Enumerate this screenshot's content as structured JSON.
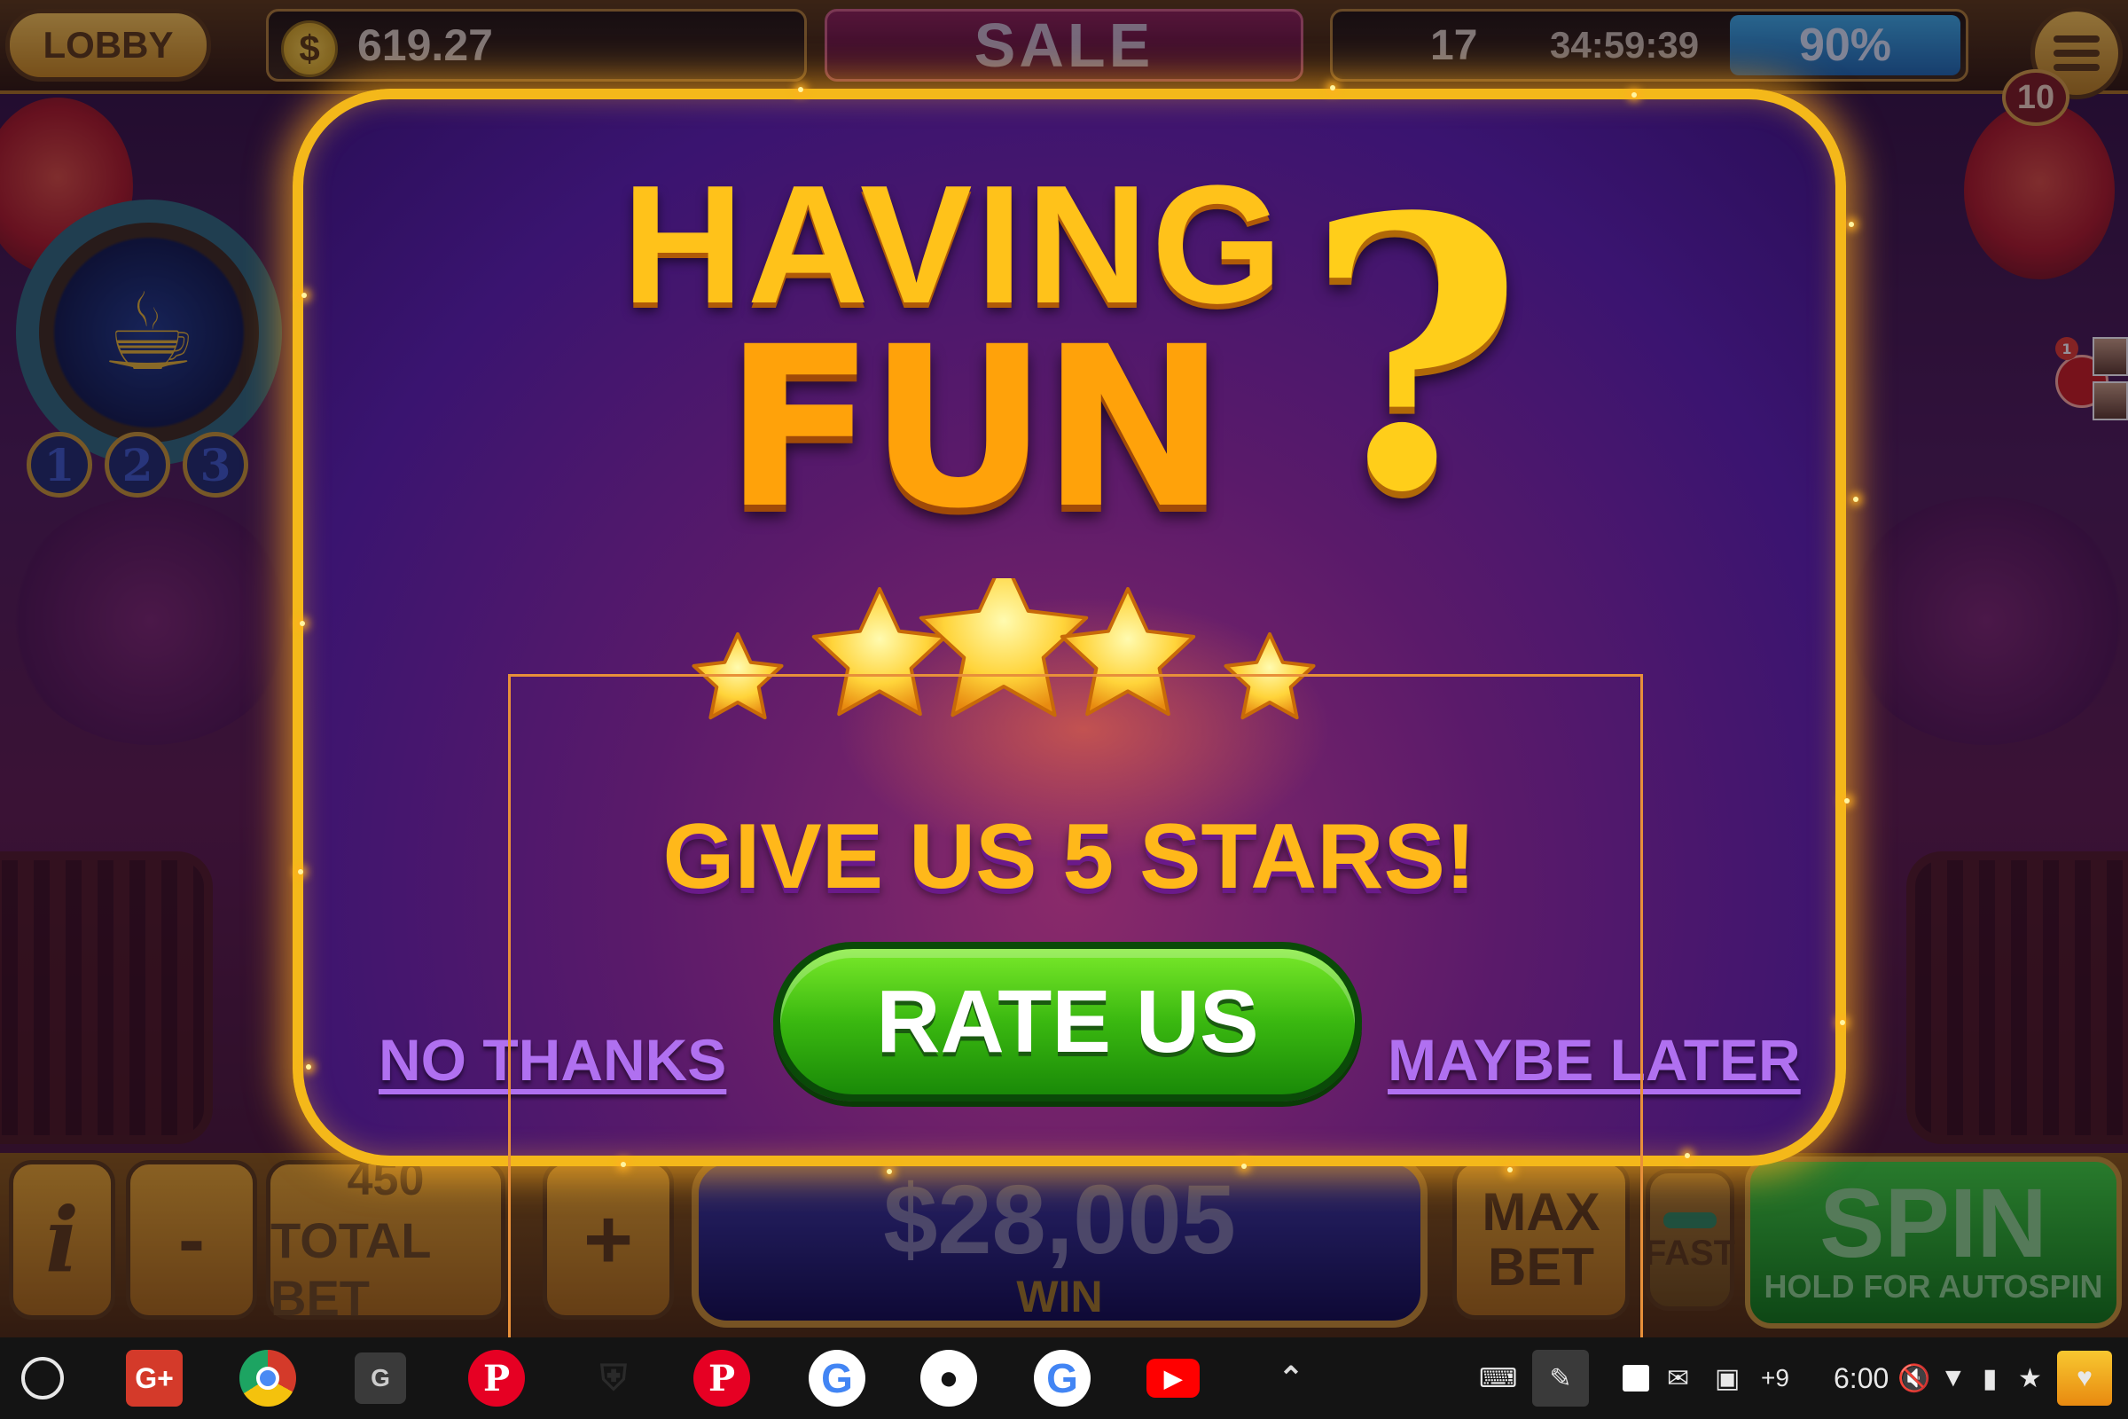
{
  "hud": {
    "lobby_label": "LOBBY",
    "coin_symbol": "$",
    "balance": "619.27",
    "sale_label": "SALE",
    "level": "17",
    "timer": "34:59:39",
    "xp_percent": "90%",
    "notification_count": "10"
  },
  "lamp": {
    "icon": "genie-lamp-icon",
    "levels": [
      "1",
      "2",
      "3"
    ]
  },
  "friends": {
    "badge_count": "1"
  },
  "popup": {
    "title_line1": "HAVING",
    "title_line2": "FUN",
    "title_mark": "?",
    "stars_shown": 5,
    "cta_text": "GIVE US 5 STARS!",
    "rate_button": "RATE US",
    "no_thanks": "NO THANKS",
    "maybe_later": "MAYBE LATER",
    "border_color": "#f4b81a",
    "button_color": "#3ab810"
  },
  "bottom_bar": {
    "info_label": "i",
    "minus_label": "-",
    "total_bet_value": "450",
    "total_bet_label": "TOTAL BET",
    "plus_label": "+",
    "win_value": "$28,005",
    "win_label": "WIN",
    "max_bet_line1": "MAX",
    "max_bet_line2": "BET",
    "fast_label": "FAST",
    "spin_label": "SPIN",
    "spin_sub": "HOLD FOR AUTOSPIN"
  },
  "taskbar": {
    "apps": [
      "launcher-icon",
      "google-plus-icon",
      "chrome-icon",
      "g-app-icon",
      "pinterest-icon",
      "shield-icon",
      "pinterest-icon",
      "google-icon",
      "github-icon",
      "google-icon",
      "youtube-icon"
    ],
    "gplus_label": "G+",
    "gapp_label": "G",
    "pinterest_glyph": "P",
    "google_glyph": "G",
    "tray_more": "+9",
    "time": "6:00"
  }
}
